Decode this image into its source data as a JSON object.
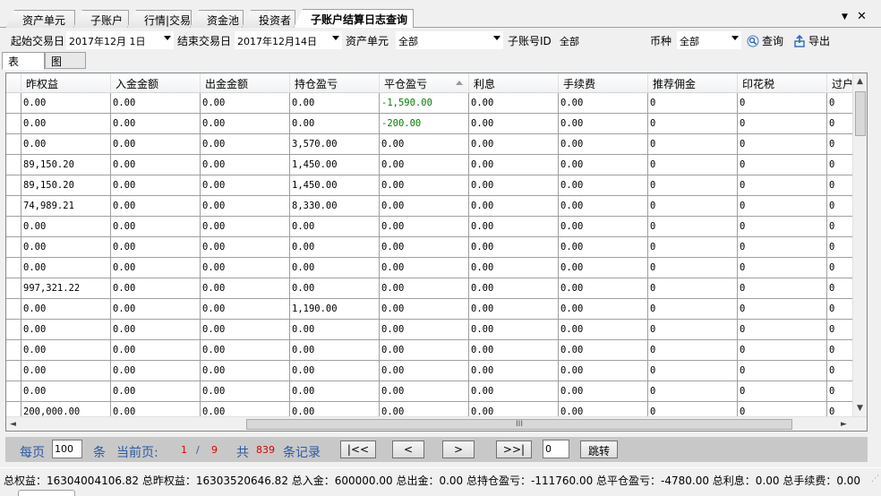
{
  "tabs": [
    {
      "label": "资产单元",
      "active": false
    },
    {
      "label": "子账户",
      "active": false
    },
    {
      "label": "行情|交易",
      "active": false
    },
    {
      "label": "资金池",
      "active": false
    },
    {
      "label": "投资者",
      "active": false
    },
    {
      "label": "子账户结算日志查询",
      "active": true
    }
  ],
  "tabbar_controls": {
    "dropdown": "▼",
    "close": "✕"
  },
  "filters": {
    "start_label": "起始交易日",
    "start_value": "2017年12月 1日",
    "end_label": "结束交易日",
    "end_value": "2017年12月14日",
    "asset_label": "资产单元",
    "asset_value": "全部",
    "subaccount_label": "子账号ID",
    "subaccount_value": "全部",
    "currency_label": "币种",
    "currency_value": "全部",
    "query_label": "查询",
    "export_label": "导出"
  },
  "view_tabs": {
    "table": "表",
    "chart": "图"
  },
  "grid": {
    "columns": [
      "昨权益",
      "入金金额",
      "出金金额",
      "持仓盈亏",
      "平仓盈亏",
      "利息",
      "手续费",
      "推荐佣金",
      "印花税",
      "过户"
    ],
    "rows": [
      [
        "0.00",
        "0.00",
        "0.00",
        "0.00",
        "-1,590.00",
        "0.00",
        "0.00",
        "0",
        "0",
        "0"
      ],
      [
        "0.00",
        "0.00",
        "0.00",
        "0.00",
        "-200.00",
        "0.00",
        "0.00",
        "0",
        "0",
        "0"
      ],
      [
        "0.00",
        "0.00",
        "0.00",
        "3,570.00",
        "0.00",
        "0.00",
        "0.00",
        "0",
        "0",
        "0"
      ],
      [
        "89,150.20",
        "0.00",
        "0.00",
        "1,450.00",
        "0.00",
        "0.00",
        "0.00",
        "0",
        "0",
        "0"
      ],
      [
        "89,150.20",
        "0.00",
        "0.00",
        "1,450.00",
        "0.00",
        "0.00",
        "0.00",
        "0",
        "0",
        "0"
      ],
      [
        "74,989.21",
        "0.00",
        "0.00",
        "8,330.00",
        "0.00",
        "0.00",
        "0.00",
        "0",
        "0",
        "0"
      ],
      [
        "0.00",
        "0.00",
        "0.00",
        "0.00",
        "0.00",
        "0.00",
        "0.00",
        "0",
        "0",
        "0"
      ],
      [
        "0.00",
        "0.00",
        "0.00",
        "0.00",
        "0.00",
        "0.00",
        "0.00",
        "0",
        "0",
        "0"
      ],
      [
        "0.00",
        "0.00",
        "0.00",
        "0.00",
        "0.00",
        "0.00",
        "0.00",
        "0",
        "0",
        "0"
      ],
      [
        "997,321.22",
        "0.00",
        "0.00",
        "0.00",
        "0.00",
        "0.00",
        "0.00",
        "0",
        "0",
        "0"
      ],
      [
        "0.00",
        "0.00",
        "0.00",
        "1,190.00",
        "0.00",
        "0.00",
        "0.00",
        "0",
        "0",
        "0"
      ],
      [
        "0.00",
        "0.00",
        "0.00",
        "0.00",
        "0.00",
        "0.00",
        "0.00",
        "0",
        "0",
        "0"
      ],
      [
        "0.00",
        "0.00",
        "0.00",
        "0.00",
        "0.00",
        "0.00",
        "0.00",
        "0",
        "0",
        "0"
      ],
      [
        "0.00",
        "0.00",
        "0.00",
        "0.00",
        "0.00",
        "0.00",
        "0.00",
        "0",
        "0",
        "0"
      ],
      [
        "0.00",
        "0.00",
        "0.00",
        "0.00",
        "0.00",
        "0.00",
        "0.00",
        "0",
        "0",
        "0"
      ],
      [
        "200,000.00",
        "0.00",
        "0.00",
        "0.00",
        "0.00",
        "0.00",
        "0.00",
        "0",
        "0",
        "0"
      ]
    ],
    "negative_color": "#008000",
    "hscroll_grip": "III"
  },
  "pager": {
    "per_page_label": "每页",
    "per_page_value": "100",
    "unit_label": "条",
    "current_label": "当前页:",
    "current_page": "1",
    "separator": "/",
    "total_pages": "9",
    "total_label": "共",
    "total_records": "839",
    "records_label": "条记录",
    "first_label": "|<<",
    "prev_label": "<",
    "next_label": ">",
    "last_label": ">>|",
    "jump_value": "0",
    "jump_label": "跳转"
  },
  "status": {
    "text": "总权益：16304004106.82  总昨权益：16303520646.82  总入金：600000.00  总出金：0.00  总持仓盈亏：-111760.00  总平仓盈亏：-4780.00  总利息：0.00  总手续费：0.00"
  },
  "icons": {
    "query": "search-icon",
    "export": "export-icon"
  }
}
